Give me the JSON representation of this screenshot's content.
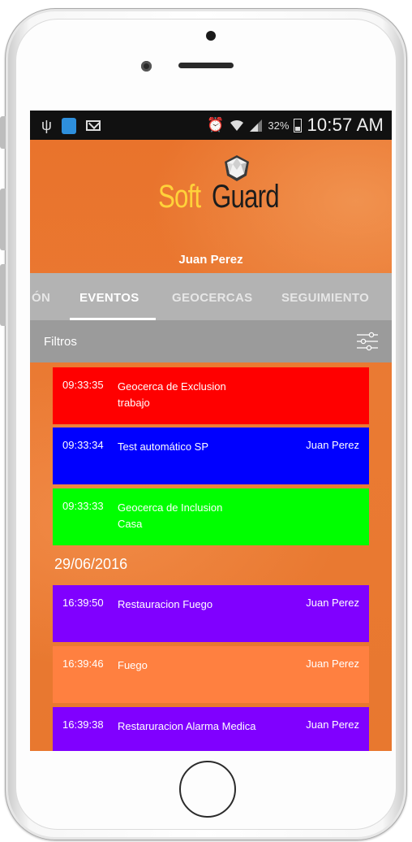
{
  "status_bar": {
    "icons_left": [
      "usb-icon",
      "app-notification-icon",
      "mail-icon"
    ],
    "icons_right": [
      "alarm-icon",
      "wifi-icon",
      "signal-icon",
      "battery-icon"
    ],
    "battery_percent": "32%",
    "time": "10:57 AM"
  },
  "header": {
    "logo_soft": "Soft",
    "logo_guard": "Guard",
    "user_name": "Juan Perez"
  },
  "tabs": {
    "partial_left": "ÓN",
    "items": [
      "EVENTOS",
      "GEOCERCAS",
      "SEGUIMIENTO"
    ],
    "active": "EVENTOS"
  },
  "filters": {
    "label": "Filtros",
    "icon": "sliders-icon"
  },
  "events": [
    {
      "time": "09:33:35",
      "line1": "Geocerca de Exclusion",
      "line2": "trabajo",
      "user": "",
      "color": "#ff0000"
    },
    {
      "time": "09:33:34",
      "line1": "Test automático SP",
      "line2": "",
      "user": "Juan Perez",
      "color": "#0000ff"
    },
    {
      "time": "09:33:33",
      "line1": "Geocerca de Inclusion",
      "line2": "Casa",
      "user": "",
      "color": "#00ff00"
    }
  ],
  "date_header": "29/06/2016",
  "events_2": [
    {
      "time": "16:39:50",
      "line1": "Restauracion Fuego",
      "line2": "",
      "user": "Juan Perez",
      "color": "#8000ff"
    },
    {
      "time": "16:39:46",
      "line1": "Fuego",
      "line2": "",
      "user": "Juan Perez",
      "color": "#ff8040"
    },
    {
      "time": "16:39:38",
      "line1": "Restaruracion Alarma Medica",
      "line2": "",
      "user": "Juan Perez",
      "color": "#8000ff"
    }
  ]
}
